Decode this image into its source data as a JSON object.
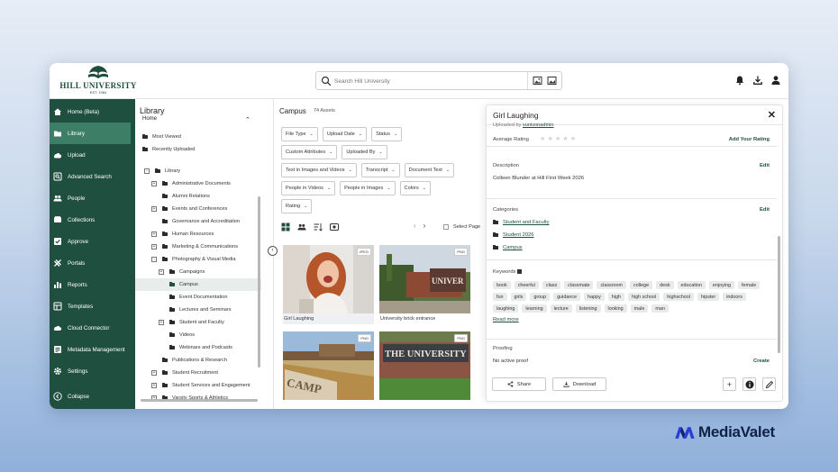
{
  "header": {
    "logo_name": "HILL UNIVERSITY",
    "logo_est": "EST. 1984",
    "search_placeholder": "Search Hill University"
  },
  "nav": {
    "items": [
      {
        "label": "Home (Beta)",
        "icon": "home-icon"
      },
      {
        "label": "Library",
        "icon": "folder-icon",
        "active": true
      },
      {
        "label": "Upload",
        "icon": "upload-icon"
      },
      {
        "label": "Advanced Search",
        "icon": "advanced-search-icon"
      },
      {
        "label": "People",
        "icon": "people-icon"
      },
      {
        "label": "Collections",
        "icon": "collections-icon"
      },
      {
        "label": "Approve",
        "icon": "approve-icon"
      },
      {
        "label": "Portals",
        "icon": "portals-icon"
      },
      {
        "label": "Reports",
        "icon": "reports-icon"
      },
      {
        "label": "Templates",
        "icon": "templates-icon"
      },
      {
        "label": "Cloud Connector",
        "icon": "cloud-icon"
      },
      {
        "label": "Metadata Management",
        "icon": "metadata-icon"
      },
      {
        "label": "Settings",
        "icon": "gear-icon"
      }
    ],
    "collapse": "Collapse"
  },
  "library": {
    "title": "Library",
    "subtitle": "Home",
    "quick": [
      "Most Viewed",
      "Recently Uploaded"
    ],
    "tree": [
      {
        "label": "Library",
        "level": 0,
        "toggle": "-"
      },
      {
        "label": "Administrative Documents",
        "level": 1,
        "toggle": "+"
      },
      {
        "label": "Alumni Relations",
        "level": 1,
        "toggle": ""
      },
      {
        "label": "Events and Conferences",
        "level": 1,
        "toggle": "+"
      },
      {
        "label": "Governance and Accreditation",
        "level": 1,
        "toggle": ""
      },
      {
        "label": "Human Resources",
        "level": 1,
        "toggle": "+"
      },
      {
        "label": "Marketing & Communications",
        "level": 1,
        "toggle": "+"
      },
      {
        "label": "Photography & Visual Media",
        "level": 1,
        "toggle": "-"
      },
      {
        "label": "Campaigns",
        "level": 2,
        "toggle": "+"
      },
      {
        "label": "Campus",
        "level": 2,
        "toggle": "",
        "selected": true
      },
      {
        "label": "Event Documentation",
        "level": 2,
        "toggle": ""
      },
      {
        "label": "Lectures and Seminars",
        "level": 2,
        "toggle": ""
      },
      {
        "label": "Student and Faculty",
        "level": 2,
        "toggle": "+"
      },
      {
        "label": "Videos",
        "level": 2,
        "toggle": ""
      },
      {
        "label": "Webinars and Podcasts",
        "level": 2,
        "toggle": ""
      },
      {
        "label": "Publications & Research",
        "level": 1,
        "toggle": ""
      },
      {
        "label": "Student Recruitment",
        "level": 1,
        "toggle": "+"
      },
      {
        "label": "Student Services and Engagement",
        "level": 1,
        "toggle": "+"
      },
      {
        "label": "Varsity Sports & Athletics",
        "level": 1,
        "toggle": "+"
      }
    ]
  },
  "main": {
    "title": "Campus",
    "count": "74 Assets",
    "filters": [
      [
        "File Type",
        "Upload Date",
        "Status"
      ],
      [
        "Custom Attributes",
        "Uploaded By"
      ],
      [
        "Text in Images and Videos",
        "Transcript",
        "Document Text"
      ],
      [
        "People in Videos",
        "People in Images",
        "Colors"
      ],
      [
        "Rating"
      ]
    ],
    "select_page": "Select Page",
    "assets": [
      {
        "caption": "Girl Laughing",
        "type": "JPEG"
      },
      {
        "caption": "University brick entrance",
        "type": "PNG"
      },
      {
        "caption": "",
        "type": "PNG"
      },
      {
        "caption": "",
        "type": "PNG"
      }
    ]
  },
  "detail": {
    "title": "Girl Laughing",
    "uploaded_by_label": "Uploaded by",
    "uploaded_by_user": "vunivonadmin",
    "avg_rating_label": "Average Rating",
    "add_rating": "Add Your Rating",
    "description_label": "Description",
    "description_edit": "Edit",
    "description": "Colleen Blunder at Hill First Week 2026",
    "categories_label": "Categories",
    "categories_edit": "Edit",
    "categories": [
      "Student and Faculty",
      "Student 2026",
      "Campus"
    ],
    "keywords_label": "Keywords",
    "keywords": [
      "book",
      "cheerful",
      "class",
      "classmate",
      "classroom",
      "college",
      "desk",
      "education",
      "enjoying",
      "female",
      "fun",
      "girls",
      "group",
      "guidance",
      "happy",
      "high",
      "high school",
      "highschool",
      "hipster",
      "indoors",
      "laughing",
      "learning",
      "lecture",
      "listening",
      "looking",
      "male",
      "man"
    ],
    "italic_keywords": [
      "classmate"
    ],
    "read_more": "Read more",
    "proofing_label": "Proofing",
    "proofing_value": "No active proof",
    "proofing_action": "Create",
    "share": "Share",
    "download": "Download"
  },
  "brand": {
    "name": "MediaValet"
  }
}
